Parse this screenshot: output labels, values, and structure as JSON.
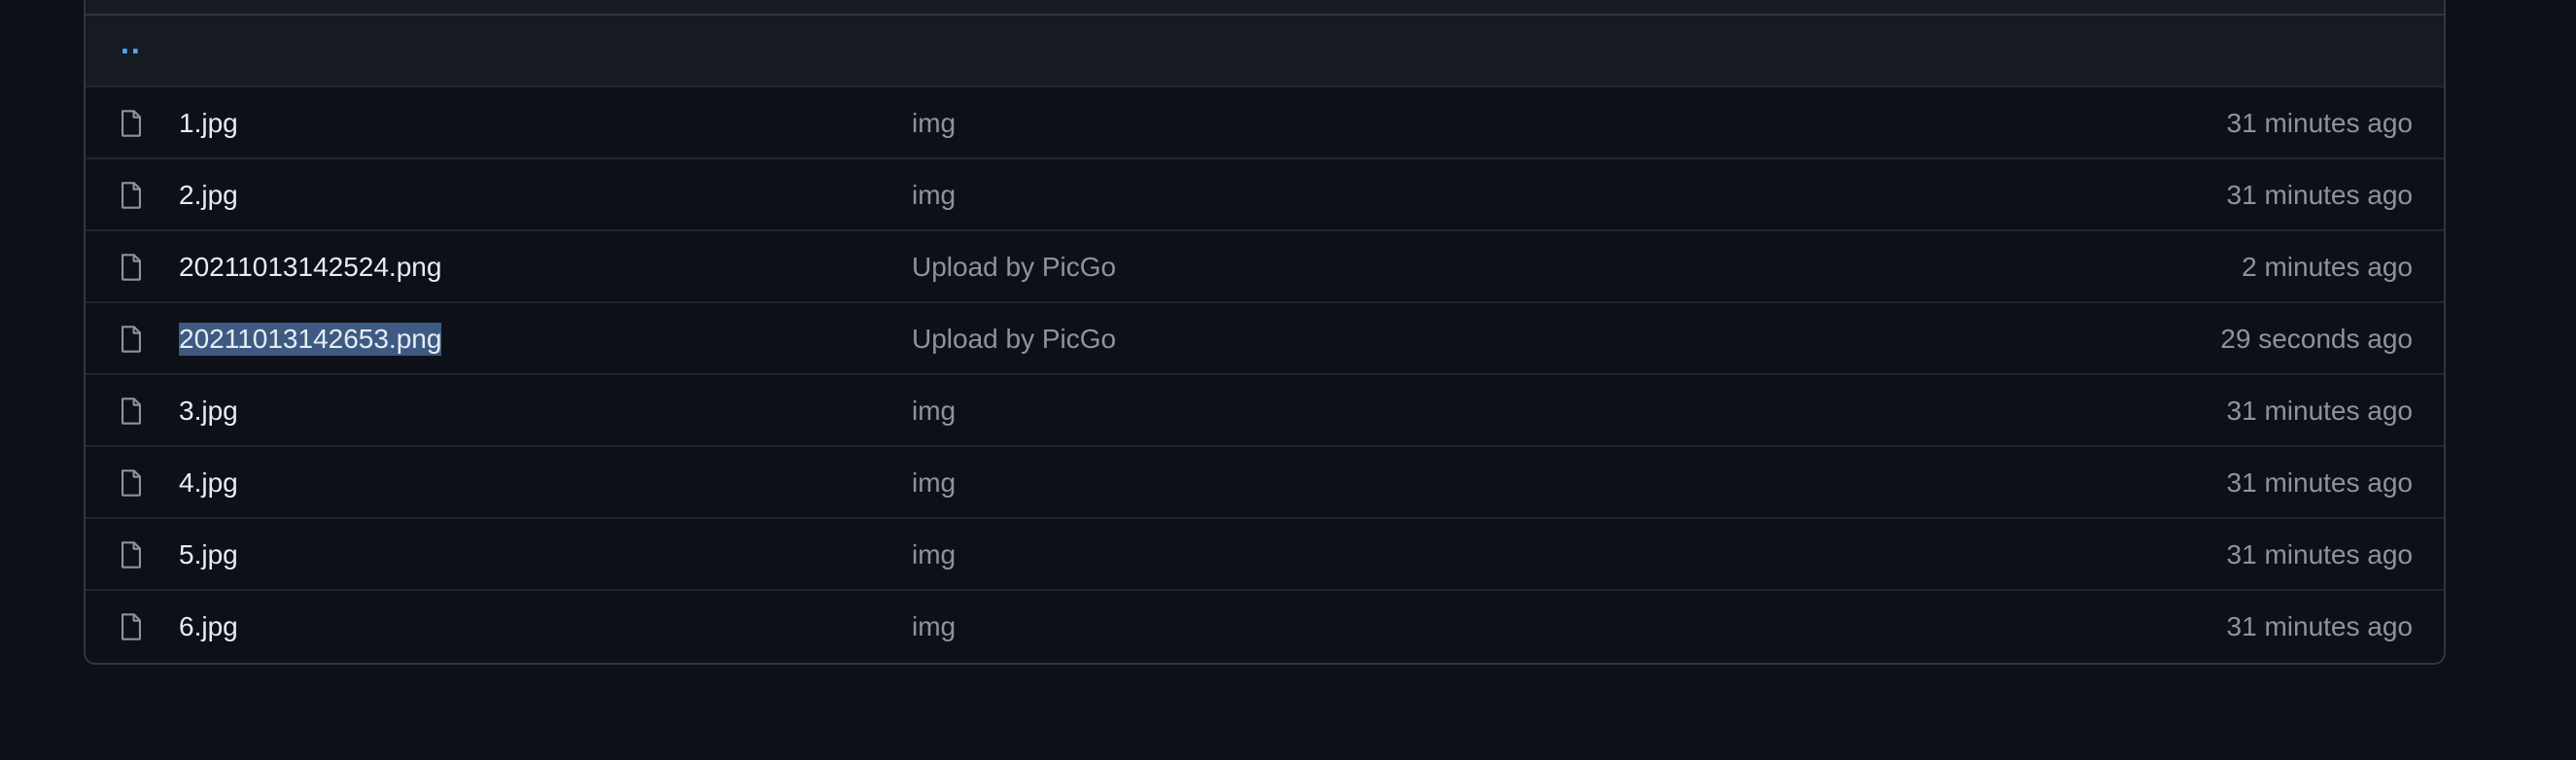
{
  "parent_directory": {
    "label": ".."
  },
  "files": [
    {
      "name": "1.jpg",
      "message": "img",
      "time": "31 minutes ago",
      "selected": false
    },
    {
      "name": "2.jpg",
      "message": "img",
      "time": "31 minutes ago",
      "selected": false
    },
    {
      "name": "20211013142524.png",
      "message": "Upload by PicGo",
      "time": "2 minutes ago",
      "selected": false
    },
    {
      "name": "20211013142653.png",
      "message": "Upload by PicGo",
      "time": "29 seconds ago",
      "selected": true
    },
    {
      "name": "3.jpg",
      "message": "img",
      "time": "31 minutes ago",
      "selected": false
    },
    {
      "name": "4.jpg",
      "message": "img",
      "time": "31 minutes ago",
      "selected": false
    },
    {
      "name": "5.jpg",
      "message": "img",
      "time": "31 minutes ago",
      "selected": false
    },
    {
      "name": "6.jpg",
      "message": "img",
      "time": "31 minutes ago",
      "selected": false
    }
  ],
  "icons": {
    "file": "file-icon"
  },
  "colors": {
    "background": "#0d1117",
    "border": "#30363d",
    "link": "#58a6ff",
    "selection": "#3e5a82"
  }
}
